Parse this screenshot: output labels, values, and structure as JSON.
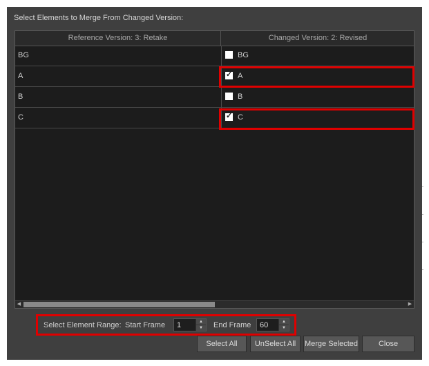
{
  "dialog": {
    "title": "Select Elements to Merge From Changed Version:"
  },
  "table": {
    "columns": {
      "reference": "Reference Version: 3: Retake",
      "changed": "Changed Version: 2: Revised"
    },
    "rows": [
      {
        "reference": "BG",
        "changed": "BG",
        "checked": false
      },
      {
        "reference": "A",
        "changed": "A",
        "checked": true
      },
      {
        "reference": "B",
        "changed": "B",
        "checked": false
      },
      {
        "reference": "C",
        "changed": "C",
        "checked": true
      }
    ]
  },
  "range": {
    "label": "Select Element Range:",
    "start_label": "Start Frame",
    "start_value": "1",
    "end_label": "End Frame",
    "end_value": "60"
  },
  "buttons": {
    "select_all": "Select All",
    "unselect_all": "UnSelect All",
    "merge_selected": "Merge Selected",
    "close": "Close"
  },
  "colors": {
    "dialog_bg": "#3f3f3f",
    "table_bg": "#1c1c1c",
    "highlight": "#e00000"
  }
}
